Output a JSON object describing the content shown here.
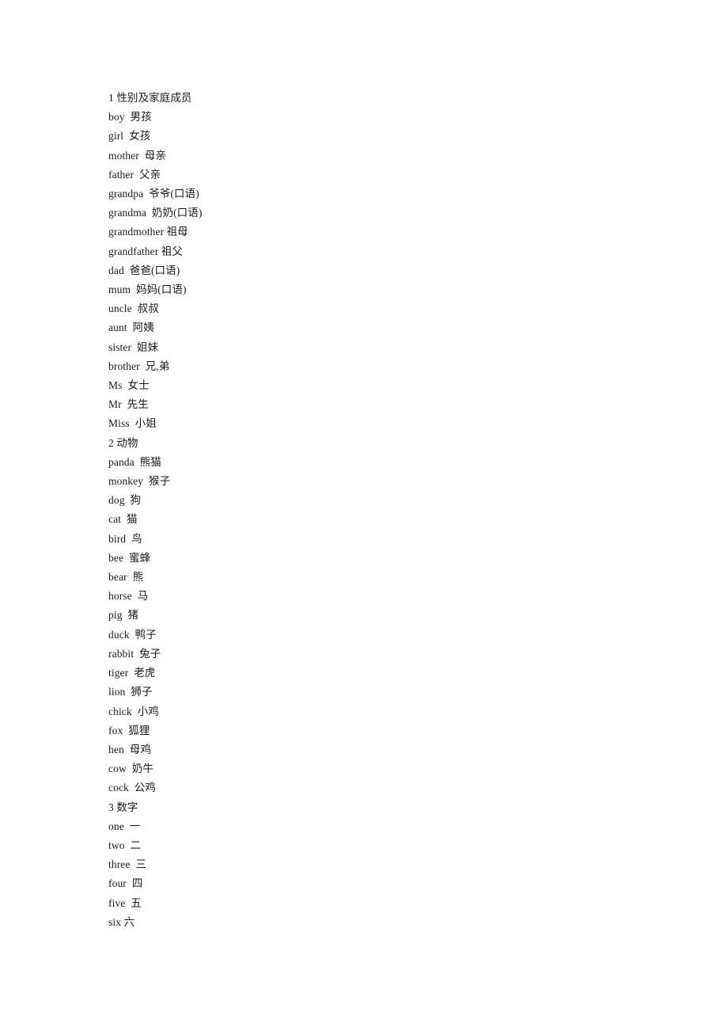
{
  "document": {
    "type": "vocabulary-list",
    "background_color": "#ffffff",
    "text_color": "#1a1a1a",
    "lines": [
      {
        "kind": "section",
        "text": "1 性别及家庭成员"
      },
      {
        "kind": "entry",
        "text": "boy  男孩"
      },
      {
        "kind": "entry",
        "text": "girl  女孩"
      },
      {
        "kind": "entry",
        "text": "mother  母亲"
      },
      {
        "kind": "entry",
        "text": "father  父亲"
      },
      {
        "kind": "entry",
        "text": "grandpa  爷爷(口语)"
      },
      {
        "kind": "entry",
        "text": "grandma  奶奶(口语)"
      },
      {
        "kind": "entry",
        "text": "grandmother 祖母"
      },
      {
        "kind": "entry",
        "text": "grandfather 祖父"
      },
      {
        "kind": "entry",
        "text": "dad  爸爸(口语)"
      },
      {
        "kind": "entry",
        "text": "mum  妈妈(口语)"
      },
      {
        "kind": "entry",
        "text": "uncle  叔叔"
      },
      {
        "kind": "entry",
        "text": "aunt  阿姨"
      },
      {
        "kind": "entry",
        "text": "sister  姐妹"
      },
      {
        "kind": "entry",
        "text": "brother  兄,弟"
      },
      {
        "kind": "entry",
        "text": "Ms  女士"
      },
      {
        "kind": "entry",
        "text": "Mr  先生"
      },
      {
        "kind": "entry",
        "text": "Miss  小姐"
      },
      {
        "kind": "section",
        "text": "2 动物"
      },
      {
        "kind": "entry",
        "text": "panda  熊猫"
      },
      {
        "kind": "entry",
        "text": "monkey  猴子"
      },
      {
        "kind": "entry",
        "text": "dog  狗"
      },
      {
        "kind": "entry",
        "text": "cat  猫"
      },
      {
        "kind": "entry",
        "text": "bird  鸟"
      },
      {
        "kind": "entry",
        "text": "bee  蜜蜂"
      },
      {
        "kind": "entry",
        "text": "bear  熊"
      },
      {
        "kind": "entry",
        "text": "horse  马"
      },
      {
        "kind": "entry",
        "text": "pig  猪"
      },
      {
        "kind": "entry",
        "text": "duck  鸭子"
      },
      {
        "kind": "entry",
        "text": "rabbit  兔子"
      },
      {
        "kind": "entry",
        "text": "tiger  老虎"
      },
      {
        "kind": "entry",
        "text": "lion  狮子"
      },
      {
        "kind": "entry",
        "text": "chick  小鸡"
      },
      {
        "kind": "entry",
        "text": "fox  狐狸"
      },
      {
        "kind": "entry",
        "text": "hen  母鸡"
      },
      {
        "kind": "entry",
        "text": "cow  奶牛"
      },
      {
        "kind": "entry",
        "text": "cock  公鸡"
      },
      {
        "kind": "section",
        "text": "3 数字"
      },
      {
        "kind": "entry",
        "text": "one  一"
      },
      {
        "kind": "entry",
        "text": "two  二"
      },
      {
        "kind": "entry",
        "text": "three  三"
      },
      {
        "kind": "entry",
        "text": "four  四"
      },
      {
        "kind": "entry",
        "text": "five  五"
      },
      {
        "kind": "entry",
        "text": "six 六"
      }
    ]
  }
}
